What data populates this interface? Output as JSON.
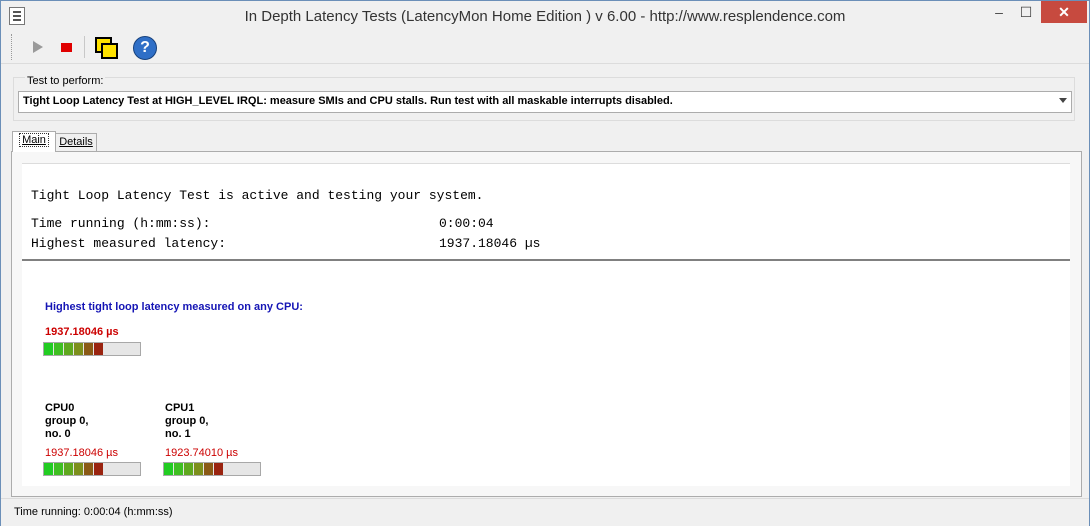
{
  "window": {
    "title": "In Depth Latency Tests  (LatencyMon Home Edition )  v 6.00 - http://www.resplendence.com",
    "min_glyph": "–",
    "max_glyph": "☐",
    "close_glyph": "✕"
  },
  "toolbar": {
    "play_icon": "play-icon",
    "stop_icon": "stop-icon",
    "windows_icon": "windows-icon",
    "help_icon": "help-icon",
    "help_glyph": "?"
  },
  "test_select": {
    "label": "Test to perform:",
    "value": "Tight Loop Latency Test at HIGH_LEVEL IRQL:  measure SMIs and CPU stalls. Run test with all maskable interrupts disabled."
  },
  "tabs": [
    {
      "label": "Main",
      "active": true
    },
    {
      "label": "Details",
      "active": false
    }
  ],
  "info": {
    "status_line": "Tight Loop Latency Test is active and testing your system.",
    "time_running_label": "Time running (h:mm:ss):",
    "time_running_value": "0:00:04",
    "highest_label": "Highest measured latency:",
    "highest_value": "1937.18046 µs"
  },
  "overall": {
    "label": "Highest tight loop latency measured on any CPU:",
    "value": "1937.18046 µs",
    "meter_segments": 6
  },
  "cpus": [
    {
      "name": "CPU0",
      "group": "group 0,",
      "no": "no. 0",
      "value": "1937.18046 µs",
      "meter_segments": 6
    },
    {
      "name": "CPU1",
      "group": "group 0,",
      "no": "no. 1",
      "value": "1923.74010 µs",
      "meter_segments": 6
    }
  ],
  "meter_colors": [
    "#22cc22",
    "#3fbf22",
    "#5fa81f",
    "#7c8f1c",
    "#8a5a16",
    "#9a2410"
  ],
  "statusbar": {
    "text": "Time running: 0:00:04  (h:mm:ss)"
  }
}
